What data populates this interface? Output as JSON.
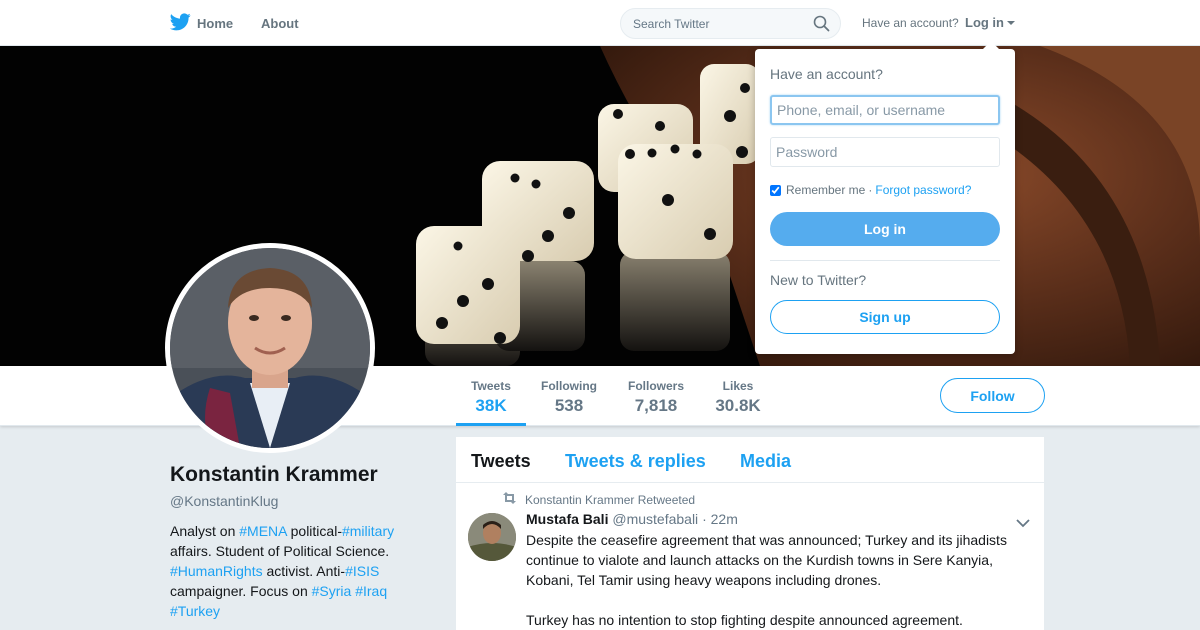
{
  "nav": {
    "home_label": "Home",
    "about_label": "About",
    "search_placeholder": "Search Twitter",
    "have_account": "Have an account?",
    "login_label": "Log in"
  },
  "profile": {
    "name": "Konstantin Krammer",
    "handle": "@KonstantinKlug",
    "bio": {
      "t1": "Analyst on ",
      "h1": "#MENA",
      "t2": " political-",
      "h2": "#military",
      "t3": " affairs. Student of Political Science. ",
      "h3": "#HumanRights",
      "t4": " activist. Anti-",
      "h4": "#ISIS",
      "t5": " campaigner. Focus on ",
      "h5": "#Syria",
      "t6": " ",
      "h6": "#Iraq",
      "t7": " ",
      "h7": "#Turkey"
    },
    "follow_label": "Follow"
  },
  "stats": [
    {
      "label": "Tweets",
      "value": "38K"
    },
    {
      "label": "Following",
      "value": "538"
    },
    {
      "label": "Followers",
      "value": "7,818"
    },
    {
      "label": "Likes",
      "value": "30.8K"
    }
  ],
  "timeline": {
    "tabs": [
      "Tweets",
      "Tweets & replies",
      "Media"
    ],
    "tweet": {
      "retweet_context": "Konstantin Krammer Retweeted",
      "author_name": "Mustafa Bali",
      "author_handle": "@mustefabali",
      "separator": "·",
      "time": "22m",
      "text_p1": "Despite the ceasefire agreement that was announced; Turkey and its jihadists continue to vialote and launch attacks on the Kurdish towns in Sere Kanyia, Kobani, Tel Tamir using heavy weapons including drones.",
      "text_p2": "Turkey has no intention to stop fighting despite announced agreement."
    }
  },
  "login_dropdown": {
    "title": "Have an account?",
    "username_placeholder": "Phone, email, or username",
    "password_placeholder": "Password",
    "remember_label": "Remember me",
    "separator": "·",
    "forgot_label": "Forgot password?",
    "login_button": "Log in",
    "new_to_twitter": "New to Twitter?",
    "signup_button": "Sign up"
  },
  "colors": {
    "accent": "#1da1f2",
    "login_button": "#55acee",
    "page_background": "#e6ecf0"
  }
}
